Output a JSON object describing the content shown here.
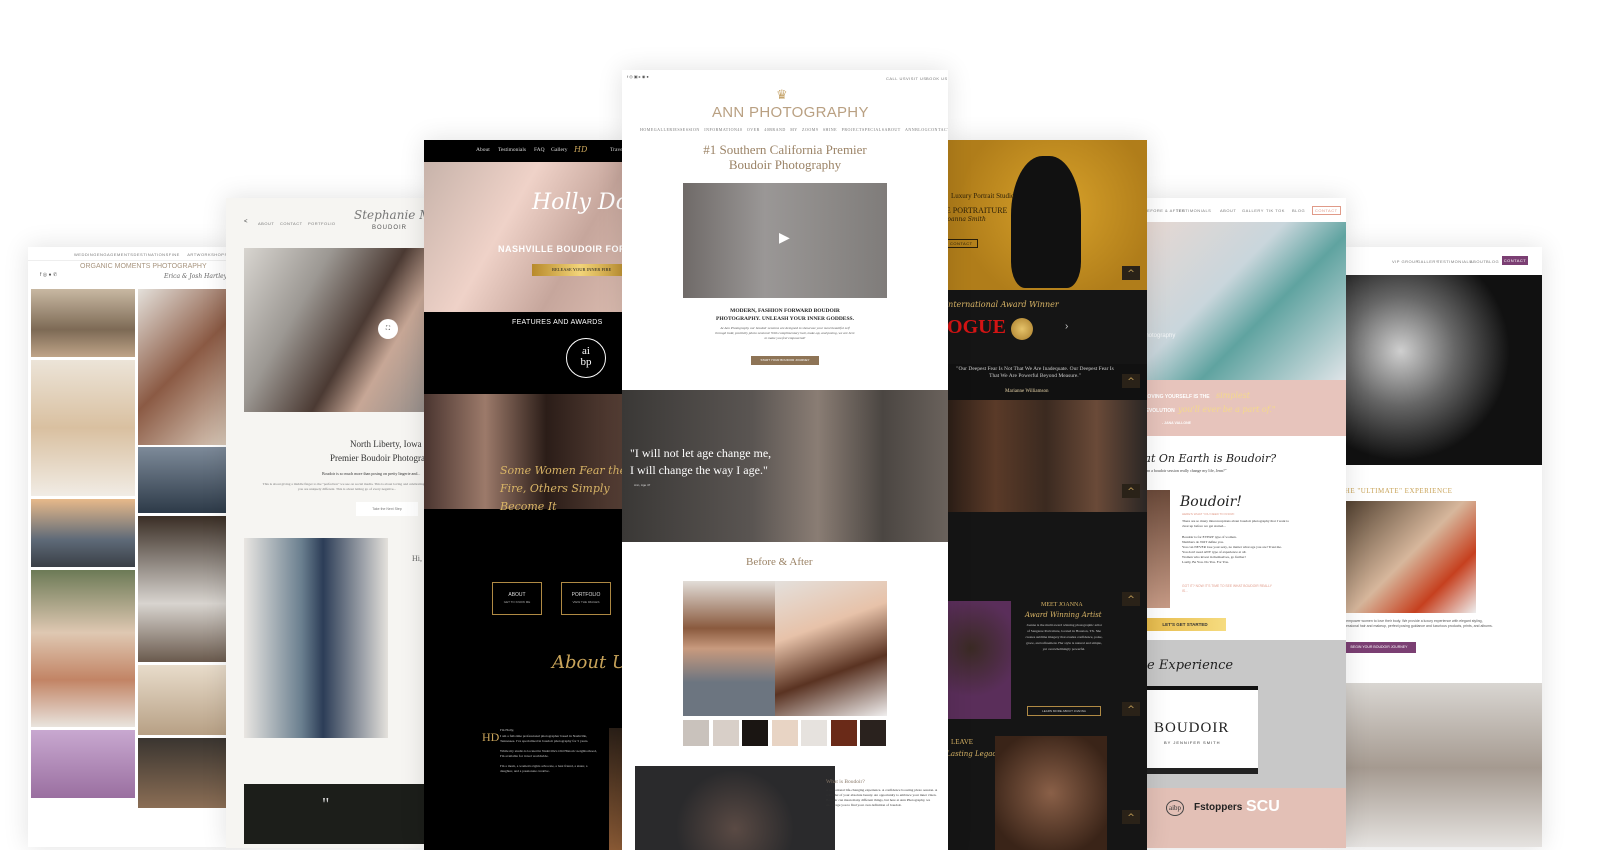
{
  "colors": {
    "gold": "#c9a45a",
    "ann_brown": "#9b8366",
    "pink": "#e7c4bc",
    "purple": "#7b3f73",
    "black": "#0b0b0b"
  },
  "site1": {
    "nav": [
      "WEDDING",
      "ENGAGEMENTS",
      "DESTINATIONS",
      "FINE ART",
      "WORKSHOPS",
      "ABOUT"
    ],
    "brand": "ORGANIC MOMENTS PHOTOGRAPHY",
    "signature": "Erica & Josh Hartley"
  },
  "site2": {
    "nav": [
      "ABOUT",
      "CONTACT",
      "PORTFOLIO"
    ],
    "logo_script": "Stephanie Marie",
    "logo_sub": "BOUDOIR",
    "heading1": "North Liberty, Iowa",
    "heading2": "Premier Boudoir Photographer",
    "intro": "Boudoir is so much more than posing on pretty lingerie and...",
    "body": "This is about giving a middle finger to the \"perfection\" we see on social media. This is about loving and celebrating how you are uniquely different. This is about letting go of every negative...",
    "button": "Take the Next Step",
    "hi": "Hi,",
    "quote_mark": "\""
  },
  "site3": {
    "nav": [
      "About",
      "Testimonials",
      "FAQ",
      "Gallery",
      "Travel"
    ],
    "logo": "Holly Douglas Boudoir",
    "hero_title": "NASHVILLE BOUDOIR FOR ALL",
    "hero_button": "RELEASE YOUR INNER FIRE",
    "features": "FEATURES AND AWARDS",
    "badge_top": "ai",
    "badge_bottom": "bp",
    "script_quote": "Some Women Fear the Fire, Others Simply Become It",
    "about_btn": "ABOUT",
    "about_sub": "GET TO KNOW ME",
    "portfolio_btn": "PORTFOLIO",
    "portfolio_sub": "VIEW THE IMAGES",
    "about_script": "About Us",
    "monogram": "HD",
    "bio": [
      "I'm Holly,",
      "I am a full-time professional photographer based in Nashville, Tennessee. I've specialized in boudoir photography for 5 years.",
      "While my studio is located in Nashville's Old Historic neighborhood, I'm available for travel worldwide.",
      "I'm a mom, a women's rights advocate, a best friend, a sister, a daughter, and a passionate creative."
    ]
  },
  "site4": {
    "top_links": [
      "CALL US",
      "VISIT US",
      "BOOK US"
    ],
    "brand": "ANN PHOTOGRAPHY",
    "nav": [
      "HOME",
      "GALLERIES",
      "SESSION INFORMATION",
      "40 OVER 40",
      "BRAND MY ZOOM",
      "9 SHINE PROJECT",
      "SPECIALS",
      "ABOUT ANN",
      "BLOG",
      "CONTACT"
    ],
    "title_line1": "#1 Southern California Premier",
    "title_line2": "Boudoir Photography",
    "tagline_line1": "MODERN, FASHION FORWARD BOUDOIR",
    "tagline_line2": "PHOTOGRAPHY. UNLEASH YOUR INNER GODDESS.",
    "intro": "At Ann Photography our boudoir sessions are designed to showcase your most beautiful self through bold, positivity photo sessions! With complimentary hair, make-up, and posing, we are here to make you feel empowered!",
    "cta": "START YOUR BOUDOIR JOURNEY",
    "quote_line1": "\"I will not let age change me,",
    "quote_line2": "I will change the way I age.\"",
    "quote_author": "Ann, Age 47",
    "before_after": "Before & After",
    "what_title": "What is Boudoir?",
    "what_body": "A sensational life-changing experience. A confidence boosting photo session. A reminder of your absolute beauty. An opportunity to embrace your inner vixen. Boudoir can mean many different things, but here at Ann Photography, we encourage you to find your own definition of boudoir."
  },
  "site5": {
    "studio": "Luxury Portrait Studio",
    "title": "FINE PORTRAITURE",
    "signature": "Joanna Smith",
    "button": "CONTACT",
    "award_script": "International Award Winner",
    "vogue": "VOGUE",
    "quote": "\"Our Deepest Fear Is Not That We Are Inadequate. Our Deepest Fear Is That We Are Powerful Beyond Measure.\"",
    "quote_author": "Marianne Williamson",
    "meet": "MEET JOANNA",
    "meet_script": "Award Winning Artist",
    "meet_body": "Joanna is the multi award winning photographic artist of Sangaree Portraiture, located in Houston, TX. She creates sublime imagery that exudes confidence, poise, grace, and refinement. Her style is natural and simple, yet overwhelmingly powerful.",
    "meet_button": "LEARN MORE ABOUT JOANNA",
    "legacy_head": "LEAVE",
    "legacy_script": "A Lasting Legacy"
  },
  "site6": {
    "nav": [
      "BEFORE & AFTER",
      "TESTIMONIALS",
      "ABOUT",
      "GALLERY",
      "TIK TOK",
      "BLOG",
      "CONTACT"
    ],
    "watermark": "photography",
    "quote_a": "\"LOVING YOURSELF IS THE",
    "quote_a_script": "simplest",
    "quote_b": "REVOLUTION",
    "quote_b_script": "you'll ever be a part of.\"",
    "quote_author": "- JANA VALLONE",
    "what_title": "What On Earth is Boudoir?",
    "what_sub": "\"Can a boudoir session really change my life, Jenn?\"",
    "boudoir_title": "Boudoir!",
    "boudoir_sub": "HERE'S WHAT YOU NEED TO KNOW:",
    "boudoir_intro": "There are so many misconceptions about boudoir photography that I want to clear up before we get started...",
    "bullets": [
      "Boudoir is for EVERY type of woman.",
      "Numbers do NOT define you.",
      "You can NEVER lose your sexy, no matter what age you are! Trust me.",
      "You don't need ANY type of experience at all.",
      "Women who invest in themselves, go further!",
      "Lastly, Be You. Do You. For You."
    ],
    "got_it": "GOT IT? NOW IT'S TIME TO SEE WHAT BOUDOIR REALLY IS...",
    "cta": "LET'S GET STARTED",
    "experience": "The Experience",
    "video_logo": "BOUDOIR",
    "video_sub": "BY JENNIFER SMITH",
    "logos": [
      "aibp",
      "Fstoppers",
      "SCU"
    ]
  },
  "site7": {
    "nav": [
      "VIP GROUP",
      "GALLERY",
      "TESTIMONIALS",
      "ABOUT",
      "BLOG"
    ],
    "contact": "CONTACT",
    "ultimate": "THE \"ULTIMATE\" EXPERIENCE",
    "body": "We empower women to love their body. We provide a luxury experience with elegant styling, professional hair and makeup, perfect posing guidance and luxurious products, prints, and albums.",
    "cta": "BEGIN YOUR BOUDOIR JOURNEY"
  }
}
